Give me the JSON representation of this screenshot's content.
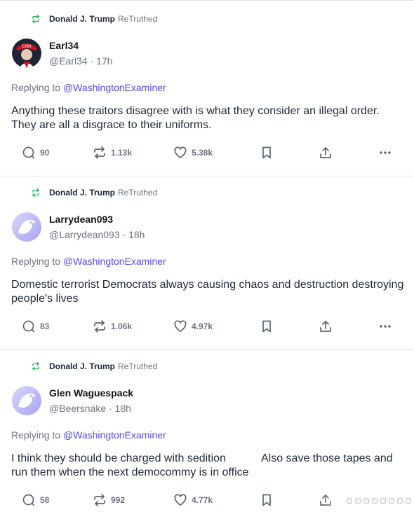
{
  "feed": {
    "posts": [
      {
        "retruth_name": "Donald J. Trump",
        "retruth_label": "ReTruthed",
        "display_name": "Earl34",
        "handle": "@Earl34",
        "time": "· 17h",
        "replying_prefix": "Replying to",
        "replying_to": "@WashingtonExaminer",
        "text": "Anything these traitors disagree with is what they consider an illegal order. They are all a disgrace to their uniforms.",
        "replies": "90",
        "retruths": "1.13k",
        "likes": "5.38k",
        "avatar": "profile-photo"
      },
      {
        "retruth_name": "Donald J. Trump",
        "retruth_label": "ReTruthed",
        "display_name": "Larrydean093",
        "handle": "@Larrydean093",
        "time": "· 18h",
        "replying_prefix": "Replying to",
        "replying_to": "@WashingtonExaminer",
        "text": "Domestic terrorist Democrats always causing chaos and destruction destroying people's lives",
        "replies": "83",
        "retruths": "1.06k",
        "likes": "4.97k",
        "avatar": "default-eagle-avatar"
      },
      {
        "retruth_name": "Donald J. Trump",
        "retruth_label": "ReTruthed",
        "display_name": "Glen Waguespack",
        "handle": "@Beersnake",
        "time": "· 18h",
        "replying_prefix": "Replying to",
        "replying_to": "@WashingtonExaminer",
        "text_part1": "I think they should be charged with sedition",
        "text_part2": "Also save those tapes and run them when the next democommy is in office",
        "replies": "58",
        "retruths": "992",
        "likes": "4.77k",
        "avatar": "default-eagle-avatar"
      }
    ]
  },
  "colors": {
    "link": "#5448ee",
    "retruth_icon": "#1db954",
    "muted": "#6b7280",
    "border": "#e5e7eb"
  }
}
